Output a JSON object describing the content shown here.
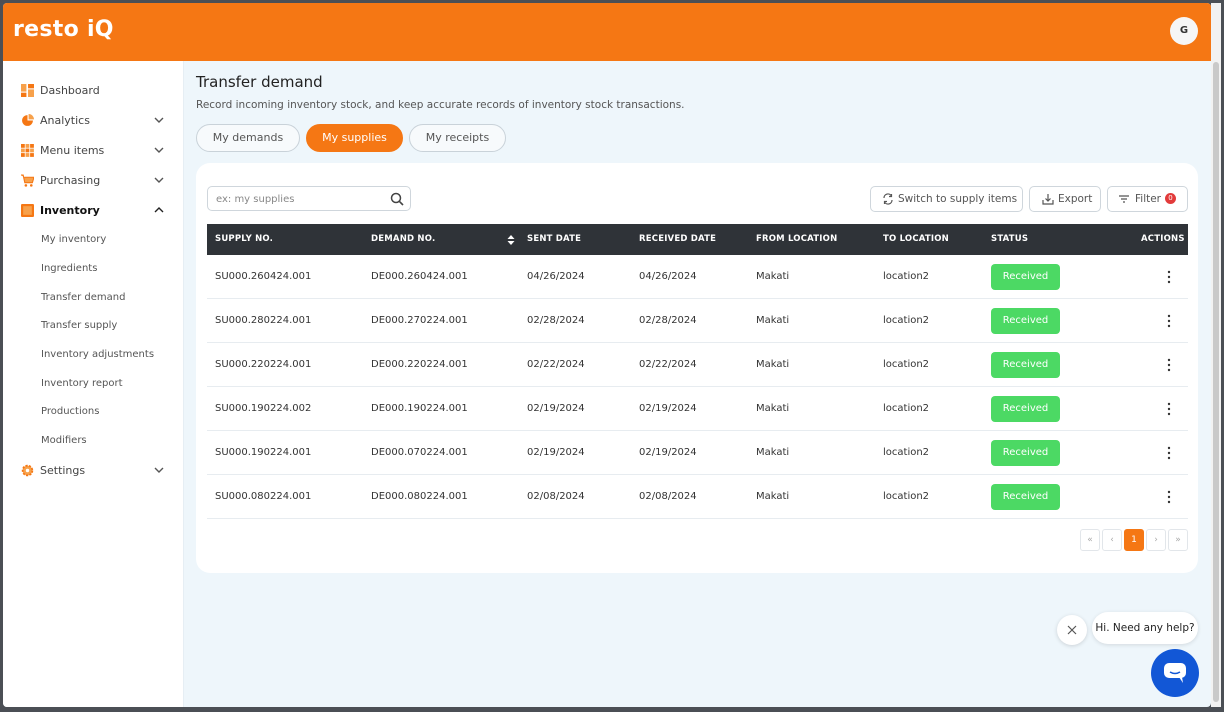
{
  "app": {
    "brand": "resto iQ",
    "avatar_initial": "G",
    "accent_color": "#f57714"
  },
  "sidebar": {
    "items": [
      {
        "label": "Dashboard",
        "icon": "dashboard-icon"
      },
      {
        "label": "Analytics",
        "icon": "analytics-icon"
      },
      {
        "label": "Menu items",
        "icon": "menu-items-icon"
      },
      {
        "label": "Purchasing",
        "icon": "cart-icon"
      },
      {
        "label": "Inventory",
        "icon": "inventory-icon"
      },
      {
        "label": "Settings",
        "icon": "gear-icon"
      }
    ],
    "inventory_sub": [
      "My inventory",
      "Ingredients",
      "Transfer demand",
      "Transfer supply",
      "Inventory adjustments",
      "Inventory report",
      "Productions",
      "Modifiers"
    ]
  },
  "page": {
    "title": "Transfer demand",
    "subtitle": "Record incoming inventory stock, and keep accurate records of inventory stock transactions."
  },
  "tabs": [
    {
      "label": "My demands",
      "active": false
    },
    {
      "label": "My supplies",
      "active": true
    },
    {
      "label": "My receipts",
      "active": false
    }
  ],
  "toolbar": {
    "search_placeholder": "ex: my supplies",
    "switch_label": "Switch to supply items",
    "export_label": "Export",
    "filter_label": "Filter",
    "filter_count": "0"
  },
  "table": {
    "columns": [
      "SUPPLY NO.",
      "DEMAND NO.",
      "SENT DATE",
      "RECEIVED DATE",
      "FROM LOCATION",
      "TO LOCATION",
      "STATUS",
      "ACTIONS"
    ],
    "rows": [
      {
        "supply": "SU000.260424.001",
        "demand": "DE000.260424.001",
        "sent": "04/26/2024",
        "received": "04/26/2024",
        "from": "Makati",
        "to": "location2",
        "status": "Received"
      },
      {
        "supply": "SU000.280224.001",
        "demand": "DE000.270224.001",
        "sent": "02/28/2024",
        "received": "02/28/2024",
        "from": "Makati",
        "to": "location2",
        "status": "Received"
      },
      {
        "supply": "SU000.220224.001",
        "demand": "DE000.220224.001",
        "sent": "02/22/2024",
        "received": "02/22/2024",
        "from": "Makati",
        "to": "location2",
        "status": "Received"
      },
      {
        "supply": "SU000.190224.002",
        "demand": "DE000.190224.001",
        "sent": "02/19/2024",
        "received": "02/19/2024",
        "from": "Makati",
        "to": "location2",
        "status": "Received"
      },
      {
        "supply": "SU000.190224.001",
        "demand": "DE000.070224.001",
        "sent": "02/19/2024",
        "received": "02/19/2024",
        "from": "Makati",
        "to": "location2",
        "status": "Received"
      },
      {
        "supply": "SU000.080224.001",
        "demand": "DE000.080224.001",
        "sent": "02/08/2024",
        "received": "02/08/2024",
        "from": "Makati",
        "to": "location2",
        "status": "Received"
      }
    ]
  },
  "pagination": {
    "first": "«",
    "prev": "‹",
    "current": "1",
    "next": "›",
    "last": "»"
  },
  "chat": {
    "greeting": "Hi. Need any help?"
  }
}
